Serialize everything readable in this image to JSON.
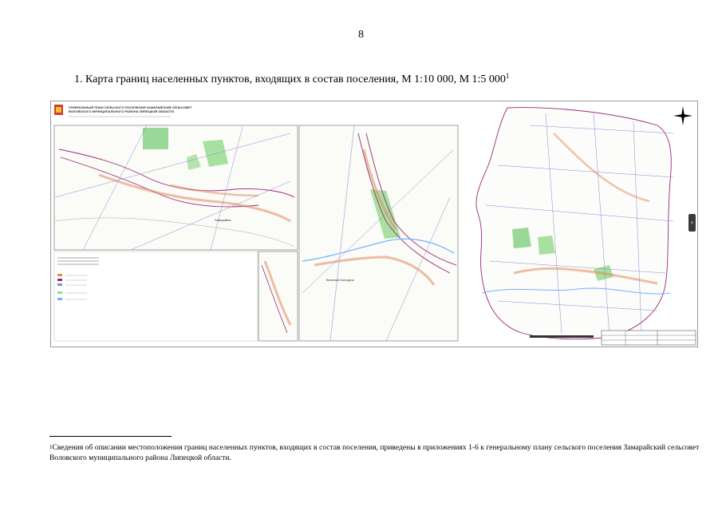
{
  "page": {
    "number": "8"
  },
  "heading": {
    "text": "1.  Карта границ населенных пунктов, входящих в состав поселения, М 1:10 000, М 1:5 000",
    "footnote_mark": "1"
  },
  "map": {
    "title_line1": "ГЕНЕРАЛЬНЫЙ ПЛАН СЕЛЬСКОГО ПОСЕЛЕНИЯ ЗАМАРАЙСКИЙ СЕЛЬСОВЕТ",
    "title_line2": "ВОЛОВСКОГО МУНИЦИПАЛЬНОГО РАЙОНА ЛИПЕЦКОЙ ОБЛАСТИ",
    "labels": {
      "zamaray": "Замарайка",
      "vesely": "Веселый Колодезь"
    },
    "colors": {
      "boundary": "#9b2a7a",
      "green": "#8fd08f",
      "roads": "#7a7ad0",
      "water": "#6fb4ff",
      "settlement": "#e8a070"
    }
  },
  "footnote": {
    "mark": "1",
    "text": "Сведения об описании местоположения границ населенных пунктов, входящих в состав поселения, приведены в приложениях 1-6 к генеральному плану сельского поселения Замарайский сельсовет Воловского муниципального района Липецкой области."
  }
}
